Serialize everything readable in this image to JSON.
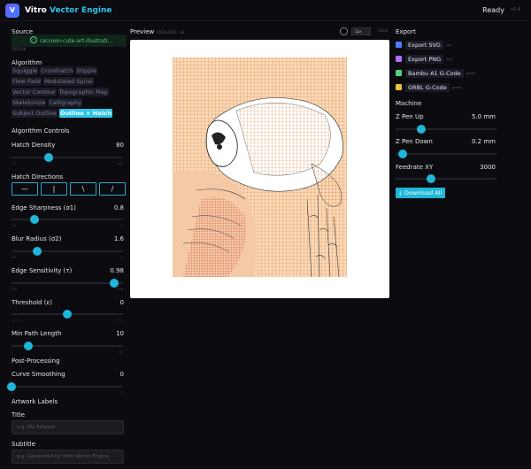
{
  "app": {
    "logo_letter": "V",
    "title_a": "Vitro",
    "title_b": "Vector Engine",
    "status": "Ready",
    "version": "v1.4"
  },
  "source": {
    "heading": "Source",
    "filename": "raccoon-cute-art-illustrati...",
    "size": "1024 kb"
  },
  "algorithm": {
    "heading": "Algorithm",
    "items": [
      "Squiggle",
      "Crosshatch",
      "Stipple",
      "Flow Field",
      "Modulated Spiral",
      "Vector Contour",
      "Topographic Map",
      "Skeletonize",
      "Calligraphy",
      "Subject Outline",
      "Outline + Hatch"
    ],
    "active": "Outline + Hatch"
  },
  "controls": {
    "heading": "Algorithm Controls",
    "hatch_density": {
      "label": "Hatch Density",
      "value": "80",
      "min": "10",
      "max": "100",
      "fraction": 0.33
    },
    "hatch_directions": {
      "label": "Hatch Directions",
      "buttons": [
        "—",
        "|",
        "\\",
        "/"
      ]
    },
    "edge_sharpness": {
      "label": "Edge Sharpness (σ1)",
      "value": "0.8",
      "min": "0.1",
      "max": "3",
      "fraction": 0.21
    },
    "blur_radius": {
      "label": "Blur Radius (σ2)",
      "value": "1.6",
      "min": "0.5",
      "max": "5",
      "fraction": 0.23
    },
    "edge_sensitivity": {
      "label": "Edge Sensitivity (τ)",
      "value": "0.98",
      "min": "0.8",
      "max": "1.00",
      "fraction": 0.92
    },
    "threshold": {
      "label": "Threshold (ε)",
      "value": "0",
      "min": "-0.1",
      "max": "0.1",
      "fraction": 0.5
    },
    "min_path_length": {
      "label": "Min Path Length",
      "value": "10",
      "min": "2",
      "max": "50",
      "fraction": 0.15
    }
  },
  "post": {
    "heading": "Post-Processing",
    "curve_smoothing": {
      "label": "Curve Smoothing",
      "value": "0",
      "min": "0",
      "max": "5",
      "fraction": 0.0
    }
  },
  "labels": {
    "heading": "Artwork Labels",
    "title_label": "Title",
    "title_placeholder": "e.g. My Artwork",
    "subtitle_label": "Subtitle",
    "subtitle_placeholder": "e.g. Generated by Vitro Vector Engine"
  },
  "preview": {
    "heading": "Preview",
    "sub": "1024x1024 · ok",
    "pen": "1px",
    "clear": "Clear"
  },
  "export": {
    "heading": "Export",
    "items": [
      {
        "label": "Export SVG",
        "ext": "svg",
        "color": "#4a7dff"
      },
      {
        "label": "Export PNG",
        "ext": "png",
        "color": "#b070ff"
      },
      {
        "label": "Bambu A1 G-Code",
        "ext": "gcode",
        "color": "#4fd27a"
      },
      {
        "label": "GRBL G-Code",
        "ext": "gcode",
        "color": "#e8c23a"
      }
    ]
  },
  "machine": {
    "heading": "Machine",
    "z_pen_up": {
      "label": "Z Pen Up",
      "value": "5.0 mm",
      "fraction": 0.25
    },
    "z_pen_down": {
      "label": "Z Pen Down",
      "value": "0.2 mm",
      "fraction": 0.07
    },
    "feedrate": {
      "label": "Feedrate XY",
      "value": "3000",
      "fraction": 0.35
    },
    "download": "Download All"
  }
}
